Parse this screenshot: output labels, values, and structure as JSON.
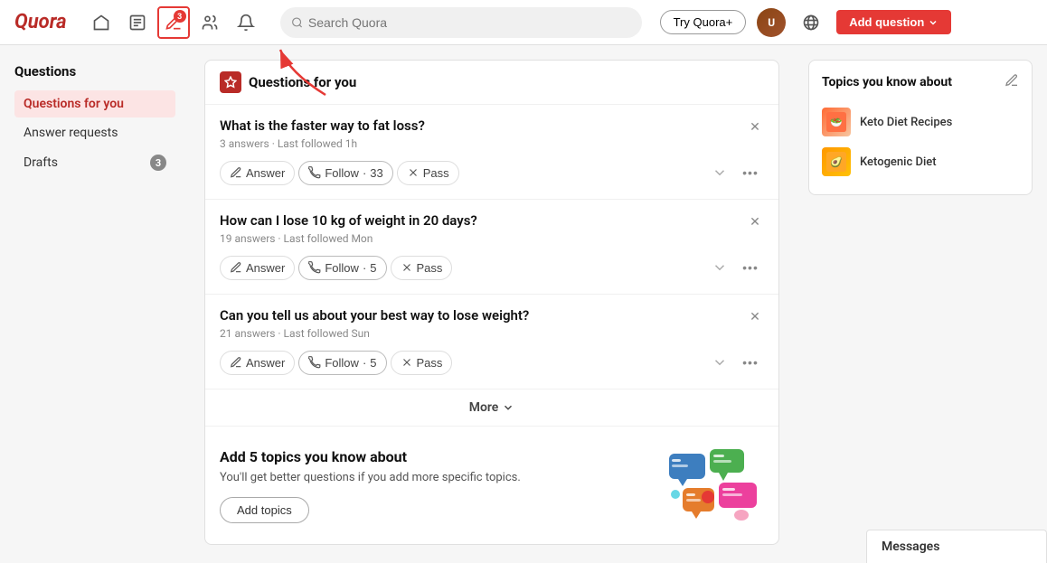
{
  "header": {
    "logo": "Quora",
    "search_placeholder": "Search Quora",
    "try_quora_label": "Try Quora+",
    "add_question_label": "Add question",
    "nav_badge": "3"
  },
  "sidebar_left": {
    "section_title": "Questions",
    "items": [
      {
        "id": "questions-for-you",
        "label": "Questions for you",
        "active": true,
        "badge": null
      },
      {
        "id": "answer-requests",
        "label": "Answer requests",
        "active": false,
        "badge": null
      },
      {
        "id": "drafts",
        "label": "Drafts",
        "active": false,
        "badge": "3"
      }
    ]
  },
  "questions_section": {
    "header_label": "Questions for you",
    "questions": [
      {
        "id": "q1",
        "title": "What is the faster way to fat loss?",
        "answers": "3 answers",
        "last_followed": "Last followed 1h",
        "answer_label": "Answer",
        "follow_label": "Follow",
        "follow_count": "33",
        "pass_label": "Pass"
      },
      {
        "id": "q2",
        "title": "How can I lose 10 kg of weight in 20 days?",
        "answers": "19 answers",
        "last_followed": "Last followed Mon",
        "answer_label": "Answer",
        "follow_label": "Follow",
        "follow_count": "5",
        "pass_label": "Pass"
      },
      {
        "id": "q3",
        "title": "Can you tell us about your best way to lose weight?",
        "answers": "21 answers",
        "last_followed": "Last followed Sun",
        "answer_label": "Answer",
        "follow_label": "Follow",
        "follow_count": "5",
        "pass_label": "Pass"
      }
    ],
    "more_label": "More",
    "add_topics_title": "Add 5 topics you know about",
    "add_topics_desc": "You'll get better questions if you add more specific topics.",
    "add_topics_btn": "Add topics"
  },
  "sidebar_right": {
    "panel_title": "Topics you know about",
    "topics": [
      {
        "id": "keto-diet",
        "name": "Keto Diet Recipes",
        "emoji": "🥗"
      },
      {
        "id": "ketogenic",
        "name": "Ketogenic Diet",
        "emoji": "🥑"
      }
    ]
  },
  "messages": {
    "label": "Messages"
  }
}
